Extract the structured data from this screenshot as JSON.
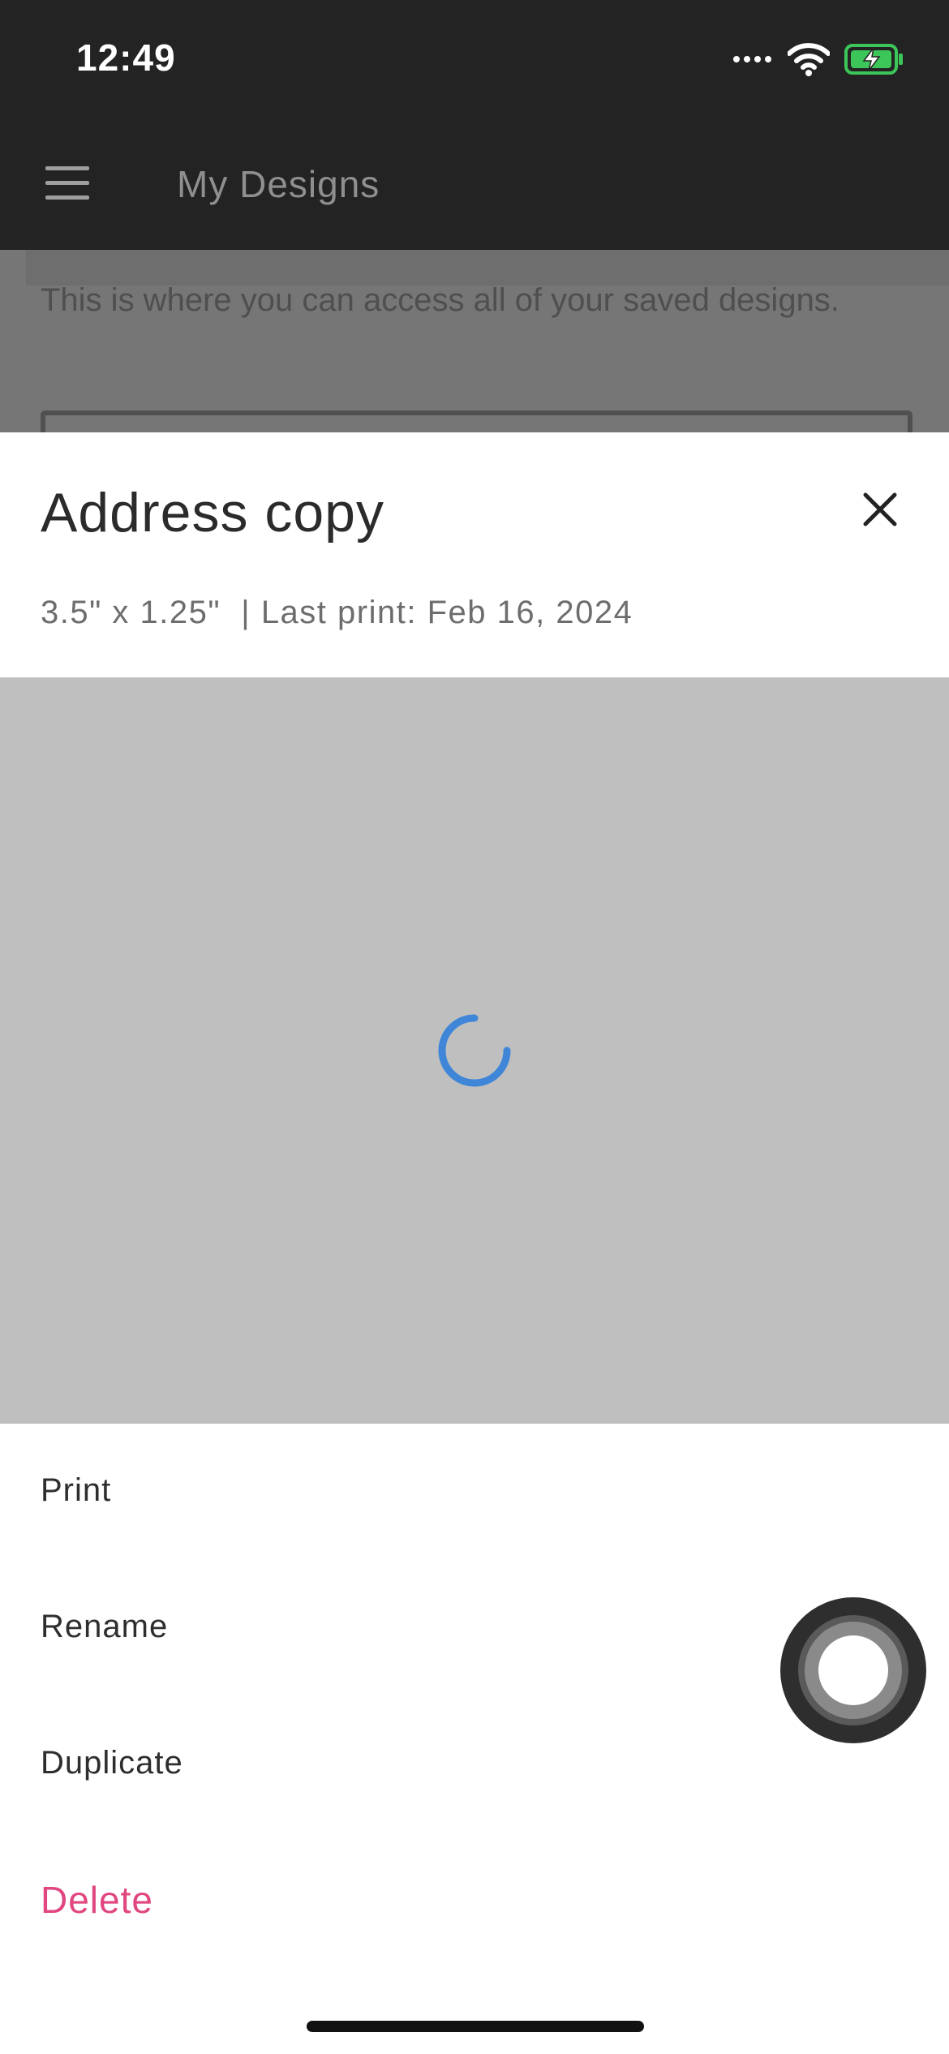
{
  "status_bar": {
    "time": "12:49",
    "icons": [
      "signal-dots-icon",
      "wifi-icon",
      "battery-charging-icon"
    ],
    "battery_color": "#3cc65a"
  },
  "app_bar": {
    "title": "My Designs",
    "menu_icon": "hamburger-menu-icon"
  },
  "page": {
    "description": "This is where you can access all of your saved designs."
  },
  "sheet": {
    "title": "Address copy",
    "meta": "3.5\" x 1.25\"  | Last print: Feb 16, 2024",
    "close_icon": "close-icon",
    "preview_state": "loading",
    "spinner_color": "#3f86d8",
    "actions": [
      {
        "label": "Print"
      },
      {
        "label": "Rename"
      },
      {
        "label": "Duplicate"
      },
      {
        "label": "Delete",
        "color": "#e0467f"
      }
    ]
  },
  "overlay": {
    "assistive_touch_icon": "assistive-touch-icon"
  }
}
